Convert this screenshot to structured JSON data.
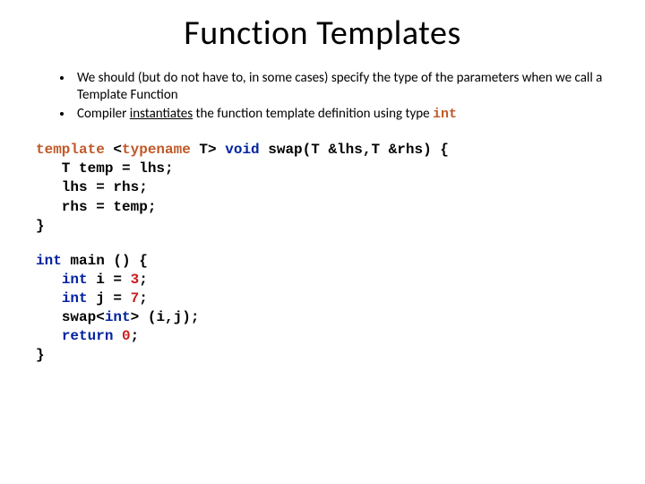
{
  "title": "Function Templates",
  "bullets": {
    "b1": "We should (but do not have to, in some cases) specify the type of the parameters when we call a Template Function",
    "b2a": "Compiler ",
    "b2u": "instantiates",
    "b2b": " the function template definition using type ",
    "b2int": "int"
  },
  "code1": {
    "l1": {
      "kw1": "template",
      "t1": " <",
      "kw2": "typename",
      "t2": " T> ",
      "kw3": "void",
      "t3": " swap(T &lhs,T &rhs) {"
    },
    "l2": "   T temp = lhs;",
    "l3": "   lhs = rhs;",
    "l4": "   rhs = temp;",
    "l5": "}"
  },
  "code2": {
    "l1": {
      "kw1": "int",
      "t1": " main () {"
    },
    "l2": {
      "pad": "   ",
      "kw1": "int",
      "t1": " i = ",
      "n1": "3",
      "t2": ";"
    },
    "l3": {
      "pad": "   ",
      "kw1": "int",
      "t1": " j = ",
      "n1": "7",
      "t2": ";"
    },
    "l4": {
      "pad": "   ",
      "t1": "swap<",
      "kw1": "int",
      "t2": "> (i,j);"
    },
    "l5": {
      "pad": "   ",
      "kw1": "return",
      "t1": " ",
      "n1": "0",
      "t2": ";"
    },
    "l6": "}"
  }
}
